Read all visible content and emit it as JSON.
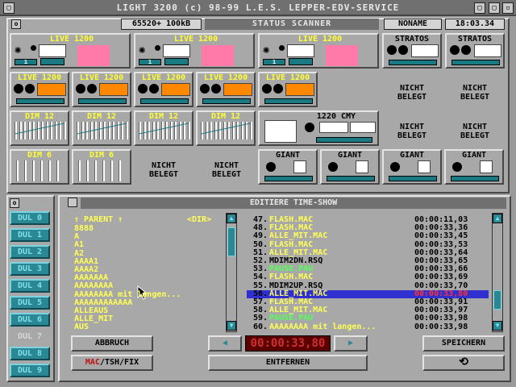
{
  "window": {
    "title": "LIGHT 3200 (c) 98-99 L.E.S. LEPPER-EDV-SERVICE",
    "close_icon": "▢",
    "min_icon": "▢",
    "max_icon": "▢"
  },
  "status": {
    "memory": "65520+ 100kB",
    "title": "STATUS SCANNER",
    "show": "NONAME",
    "clock": "18:03.34"
  },
  "devices": {
    "row1": [
      {
        "label": "LIVE 1200",
        "num": "1"
      },
      {
        "label": "LIVE 1200",
        "num": "1"
      },
      {
        "label": "LIVE 1200",
        "num": "1"
      },
      {
        "label": "STRATOS"
      },
      {
        "label": "STRATOS"
      }
    ],
    "live_small": [
      "LIVE 1200",
      "LIVE 1200",
      "LIVE 1200",
      "LIVE 1200",
      "LIVE 1200"
    ],
    "dim12": [
      "DIM 12",
      "DIM 12",
      "DIM 12",
      "DIM 12"
    ],
    "cmy": {
      "label": "1220 CMY"
    },
    "dim6": [
      "DIM 6",
      "DIM 6"
    ],
    "giant": [
      "GIANT",
      "GIANT",
      "GIANT",
      "GIANT"
    ],
    "nicht_belegt": [
      "NICHT BELEGT",
      "NICHT BELEGT",
      "NICHT BELEGT",
      "NICHT BELEGT",
      "NICHT BELEGT",
      "NICHT BELEGT"
    ],
    "colors": {
      "pink": "#ff7aa8",
      "orange": "#ff8800",
      "teal": "#1a7a84"
    }
  },
  "sidebar": {
    "items": [
      "DUL 0",
      "DUL 1",
      "DUL 2",
      "DUL 3",
      "DUL 4",
      "DUL 5",
      "DUL 6",
      "DUL 7",
      "DUL 8",
      "DUL 9"
    ]
  },
  "editor": {
    "title": "EDITIERE TIME-SHOW",
    "parent": "↑ PARENT ↑",
    "dir_tag": "<DIR>",
    "files": [
      "8888",
      "A",
      "A1",
      "A2",
      "AAAA1",
      "AAAA2",
      "AAAAAAA",
      "AAAAAAAA",
      "AAAAAAAA mit langen...",
      "AAAAAAAAAAAA",
      "ALLEAUS",
      "ALLE_MIT",
      "AUS"
    ],
    "steps": [
      {
        "n": "47.",
        "name": "FLASH.MAC",
        "time": "00:00:11,03",
        "color": "#ffff55"
      },
      {
        "n": "48.",
        "name": "FLASH.MAC",
        "time": "00:00:33,36",
        "color": "#ffff55"
      },
      {
        "n": "49.",
        "name": "ALLE_MIT.MAC",
        "time": "00:00:33,45",
        "color": "#ffff55"
      },
      {
        "n": "50.",
        "name": "FLASH.MAC",
        "time": "00:00:33,53",
        "color": "#ffff55"
      },
      {
        "n": "51.",
        "name": "ALLE_MIT.MAC",
        "time": "00:00:33,64",
        "color": "#ffff55"
      },
      {
        "n": "52.",
        "name": "MDIM2DN.RSQ",
        "time": "00:00:33,65",
        "color": "#000000"
      },
      {
        "n": "53.",
        "name": "PAUSE.PAU",
        "time": "00:00:33,66",
        "color": "#55ff55"
      },
      {
        "n": "54.",
        "name": "FLASH.MAC",
        "time": "00:00:33,69",
        "color": "#ffff55"
      },
      {
        "n": "55.",
        "name": "MDIM2UP.RSQ",
        "time": "00:00:33,70",
        "color": "#000000"
      },
      {
        "n": "56.",
        "name": "ALLE_MIT.MAC",
        "time": "00:00:33,80",
        "color": "#ffff55",
        "selected": true
      },
      {
        "n": "57.",
        "name": "FLASH.MAC",
        "time": "00:00:33,91",
        "color": "#ffff55"
      },
      {
        "n": "58.",
        "name": "ALLE_MIT.MAC",
        "time": "00:00:33,97",
        "color": "#ffff55"
      },
      {
        "n": "59.",
        "name": "PAUSE.PAU",
        "time": "00:00:33,98",
        "color": "#55ff55"
      },
      {
        "n": "60.",
        "name": "AAAAAAAA mit langen...",
        "time": "00:00:33,98",
        "color": "#ffff55"
      }
    ],
    "time_display": "00:00:33,80",
    "buttons": {
      "abbruch": "ABBRUCH",
      "fix_mac": "MAC",
      "fix_rest": "/TSH/FIX",
      "entfernen": "ENTFERNEN",
      "speichern": "SPEICHERN",
      "refresh": "⟲",
      "prev": "◀",
      "next": "▶"
    }
  }
}
